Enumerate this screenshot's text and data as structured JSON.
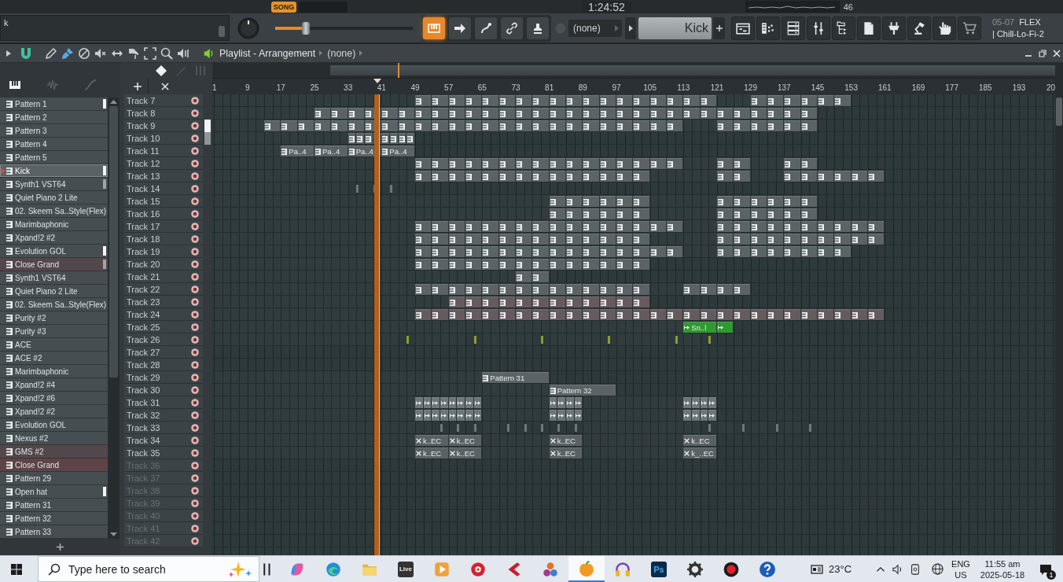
{
  "top_bar": {
    "mode": "SONG",
    "time": "1:24:52",
    "meter_reading": "46"
  },
  "toolbar": {
    "hint": "k",
    "song_position": {
      "level": 0.22
    },
    "tools": [
      {
        "on": true
      },
      {
        "on": false
      },
      {
        "on": false
      },
      {
        "on": false
      },
      {
        "on": false
      }
    ],
    "selector": "(none)",
    "pattern_field": "Kick",
    "project_info": [
      "05-07",
      "FLEX",
      "| Chill-Lo-Fi-2"
    ]
  },
  "playlist": {
    "title": "Playlist - Arrangement",
    "arrangement": "(none)",
    "tools": [
      {
        "selected": false
      },
      {
        "selected": true
      },
      {
        "selected": false
      },
      {
        "selected": false
      },
      {
        "selected": false
      },
      {
        "selected": false
      },
      {
        "selected": false
      },
      {
        "selected": false
      },
      {
        "selected": false
      }
    ],
    "picker_tabs": [
      {
        "selected": true
      },
      {
        "selected": false
      },
      {
        "selected": false
      }
    ],
    "patterns": [
      {
        "name": "Pattern 1",
        "selected": false,
        "marker": {
          "color": "#f2f4f5"
        }
      },
      {
        "name": "Pattern 2",
        "selected": false
      },
      {
        "name": "Pattern 3",
        "selected": false
      },
      {
        "name": "Pattern 4",
        "selected": false
      },
      {
        "name": "Pattern 5",
        "selected": false
      },
      {
        "name": "Kick",
        "selected": true,
        "marker": {
          "color": "#f2f4f5"
        }
      },
      {
        "name": "Synth1 VST64",
        "selected": false,
        "marker": {
          "color": "#9ea5a8"
        }
      },
      {
        "name": "Quiet Piano 2 Lite",
        "selected": false
      },
      {
        "name": "02. Skeem Sa..Style(Flex)",
        "selected": false
      },
      {
        "name": "Marimbaphonic",
        "selected": false
      },
      {
        "name": "Xpand!2 #2",
        "selected": false
      },
      {
        "name": "Evolution GOL",
        "selected": false,
        "marker": {
          "color": "#f2f4f5"
        }
      },
      {
        "name": "Close Grand",
        "selected": false,
        "color": "#54474b",
        "marker": {
          "color": "#9ea5a8"
        }
      },
      {
        "name": "Synth1 VST64",
        "selected": false
      },
      {
        "name": "Quiet Piano 2 Lite",
        "selected": false
      },
      {
        "name": "02. Skeem Sa..Style(Flex)",
        "selected": false
      },
      {
        "name": "Purity #2",
        "selected": false
      },
      {
        "name": "Purity #3",
        "selected": false
      },
      {
        "name": "ACE",
        "selected": false
      },
      {
        "name": "ACE #2",
        "selected": false
      },
      {
        "name": "Marimbaphonic",
        "selected": false
      },
      {
        "name": "Xpand!2 #4",
        "selected": false
      },
      {
        "name": "Xpand!2 #6",
        "selected": false
      },
      {
        "name": "Xpand!2 #2",
        "selected": false
      },
      {
        "name": "Evolution GOL",
        "selected": false
      },
      {
        "name": "Nexus #2",
        "selected": false
      },
      {
        "name": "GMS #2",
        "selected": false,
        "color": "#54474b"
      },
      {
        "name": "Close Grand",
        "selected": false,
        "color": "#5e4347"
      },
      {
        "name": "Pattern 29",
        "selected": false
      },
      {
        "name": "Open hat",
        "selected": false,
        "marker": {
          "color": "#f2f4f5"
        }
      },
      {
        "name": "Pattern 31",
        "selected": false
      },
      {
        "name": "Pattern 32",
        "selected": false
      },
      {
        "name": "Pattern 33",
        "selected": false
      }
    ],
    "ruler": [
      "1",
      "9",
      "17",
      "25",
      "33",
      "41",
      "49",
      "57",
      "65",
      "73",
      "81",
      "89",
      "97",
      "105",
      "113",
      "121",
      "129",
      "137",
      "145",
      "153",
      "161",
      "169",
      "177",
      "185",
      "193",
      "20"
    ],
    "playhead": {
      "level": 0.196
    },
    "tracks": [
      {
        "name": "Track 7",
        "dimmed": false,
        "kind": "pattern",
        "slots": [
          false,
          false,
          false,
          false,
          false,
          false,
          false,
          false,
          false,
          false,
          false,
          false,
          true,
          true,
          true,
          true,
          true,
          true,
          true,
          true,
          true,
          true,
          true,
          true,
          true,
          true,
          true,
          true,
          true,
          true,
          false,
          false,
          true,
          true,
          true,
          true,
          true,
          true
        ]
      },
      {
        "name": "Track 8",
        "dimmed": false,
        "kind": "pattern",
        "slots": [
          false,
          false,
          false,
          false,
          false,
          false,
          true,
          true,
          true,
          true,
          true,
          true,
          true,
          true,
          true,
          true,
          true,
          true,
          true,
          true,
          true,
          true,
          true,
          true,
          true,
          true,
          true,
          true,
          true,
          true,
          true,
          true,
          true,
          true,
          true,
          true
        ]
      },
      {
        "name": "Track 9",
        "dimmed": false,
        "kind": "pattern",
        "slots": [
          false,
          false,
          false,
          true,
          true,
          true,
          true,
          true,
          true,
          true,
          true,
          true,
          true,
          true,
          true,
          true,
          true,
          true,
          true,
          true,
          true,
          true,
          true,
          true,
          true,
          true,
          true,
          true,
          false,
          false,
          true,
          true,
          true,
          true,
          true,
          true
        ]
      },
      {
        "name": "Track 10",
        "dimmed": false,
        "kind": "split",
        "slots": [
          false,
          false,
          false,
          false,
          false,
          false,
          false,
          false,
          true,
          true,
          true,
          true
        ]
      },
      {
        "name": "Track 11",
        "dimmed": false,
        "kind": "wide",
        "labels": [
          "Pa..4",
          "Pa..4",
          "Pa..4",
          "Pa..4"
        ],
        "slots": [
          false,
          false,
          false,
          false,
          true,
          true,
          true,
          true,
          true,
          true,
          true,
          true
        ]
      },
      {
        "name": "Track 12",
        "dimmed": false,
        "kind": "pattern",
        "slots": [
          false,
          false,
          false,
          false,
          false,
          false,
          false,
          false,
          false,
          false,
          false,
          false,
          true,
          true,
          true,
          true,
          true,
          true,
          true,
          true,
          true,
          true,
          true,
          true,
          true,
          true,
          true,
          true,
          false,
          false,
          true,
          true,
          false,
          false,
          true,
          true
        ]
      },
      {
        "name": "Track 13",
        "dimmed": false,
        "kind": "pattern",
        "slots": [
          false,
          false,
          false,
          false,
          false,
          false,
          false,
          false,
          false,
          false,
          false,
          false,
          true,
          true,
          true,
          true,
          true,
          true,
          true,
          true,
          true,
          true,
          true,
          true,
          true,
          true,
          false,
          false,
          false,
          false,
          true,
          true,
          false,
          false,
          true,
          true,
          true,
          true,
          true,
          true
        ]
      },
      {
        "name": "Track 14",
        "dimmed": false,
        "kind": "marker",
        "color": "#6e7679",
        "slots": [
          false,
          false,
          false,
          false,
          false,
          false,
          false,
          false,
          true,
          true,
          true
        ]
      },
      {
        "name": "Track 15",
        "dimmed": false,
        "kind": "pattern",
        "slots": [
          false,
          false,
          false,
          false,
          false,
          false,
          false,
          false,
          false,
          false,
          false,
          false,
          false,
          false,
          false,
          false,
          false,
          false,
          false,
          false,
          true,
          true,
          true,
          true,
          true,
          true,
          false,
          false,
          false,
          false,
          true,
          true,
          true,
          true,
          true,
          true
        ]
      },
      {
        "name": "Track 16",
        "dimmed": false,
        "kind": "pattern",
        "slots": [
          false,
          false,
          false,
          false,
          false,
          false,
          false,
          false,
          false,
          false,
          false,
          false,
          false,
          false,
          false,
          false,
          false,
          false,
          false,
          false,
          true,
          true,
          true,
          true,
          true,
          true,
          false,
          false,
          false,
          false,
          true,
          true,
          true,
          true,
          true,
          true
        ]
      },
      {
        "name": "Track 17",
        "dimmed": false,
        "kind": "pattern",
        "slots": [
          false,
          false,
          false,
          false,
          false,
          false,
          false,
          false,
          false,
          false,
          false,
          false,
          true,
          true,
          true,
          true,
          true,
          true,
          true,
          true,
          true,
          true,
          true,
          true,
          true,
          true,
          true,
          true,
          false,
          false,
          true,
          true,
          true,
          true,
          true,
          true,
          true,
          true,
          true,
          true
        ]
      },
      {
        "name": "Track 18",
        "dimmed": false,
        "kind": "pattern",
        "slots": [
          false,
          false,
          false,
          false,
          false,
          false,
          false,
          false,
          false,
          false,
          false,
          false,
          true,
          true,
          true,
          true,
          true,
          true,
          true,
          true,
          true,
          true,
          true,
          true,
          true,
          true,
          false,
          false,
          false,
          false,
          true,
          true,
          true,
          true,
          true,
          true,
          true,
          true,
          true,
          true
        ]
      },
      {
        "name": "Track 19",
        "dimmed": false,
        "kind": "pattern",
        "slots": [
          false,
          false,
          false,
          false,
          false,
          false,
          false,
          false,
          false,
          false,
          false,
          false,
          true,
          true,
          true,
          true,
          true,
          true,
          true,
          true,
          true,
          true,
          true,
          true,
          true,
          true,
          true,
          true,
          false,
          false,
          true,
          true,
          true,
          true,
          true,
          true,
          true,
          true
        ]
      },
      {
        "name": "Track 20",
        "dimmed": false,
        "kind": "pattern",
        "slots": [
          false,
          false,
          false,
          false,
          false,
          false,
          false,
          false,
          false,
          false,
          false,
          false,
          true,
          true,
          true,
          true,
          true,
          true,
          true,
          true,
          true,
          true,
          true,
          true,
          true,
          true
        ]
      },
      {
        "name": "Track 21",
        "dimmed": false,
        "kind": "pattern",
        "slots": [
          false,
          false,
          false,
          false,
          false,
          false,
          false,
          false,
          false,
          false,
          false,
          false,
          false,
          false,
          false,
          false,
          false,
          false,
          true,
          true
        ]
      },
      {
        "name": "Track 22",
        "dimmed": false,
        "kind": "pattern",
        "slots": [
          false,
          false,
          false,
          false,
          false,
          false,
          false,
          false,
          false,
          false,
          false,
          false,
          true,
          true,
          true,
          true,
          true,
          true,
          true,
          true,
          true,
          true,
          true,
          true,
          true,
          true,
          false,
          false,
          true,
          true,
          true,
          true
        ]
      },
      {
        "name": "Track 23",
        "dimmed": false,
        "kind": "pattern",
        "color": "#655b5e",
        "slots": [
          false,
          false,
          false,
          false,
          false,
          false,
          false,
          false,
          false,
          false,
          false,
          false,
          false,
          false,
          true,
          true,
          true,
          true,
          true,
          true,
          true,
          true,
          true,
          true,
          true,
          true
        ]
      },
      {
        "name": "Track 24",
        "dimmed": false,
        "kind": "pattern",
        "color": "#655b5e",
        "slots": [
          false,
          false,
          false,
          false,
          false,
          false,
          false,
          false,
          false,
          false,
          false,
          false,
          true,
          true,
          true,
          true,
          true,
          true,
          true,
          true,
          true,
          true,
          true,
          true,
          true,
          true,
          true,
          true,
          true,
          true,
          true,
          true,
          true,
          true,
          true,
          true,
          true,
          true,
          true,
          true
        ]
      },
      {
        "name": "Track 25",
        "dimmed": false,
        "kind": "audio",
        "color": "#2f9a2f",
        "labels": [
          "Sn..l"
        ],
        "slots": [
          false,
          false,
          false,
          false,
          false,
          false,
          false,
          false,
          false,
          false,
          false,
          false,
          false,
          false,
          false,
          false,
          false,
          false,
          false,
          false,
          false,
          false,
          false,
          false,
          false,
          false,
          false,
          false,
          true,
          true,
          true
        ]
      },
      {
        "name": "Track 26",
        "dimmed": false,
        "kind": "marker",
        "color": "#8f9b2c",
        "slots": [
          false,
          false,
          false,
          false,
          false,
          false,
          false,
          false,
          false,
          false,
          false,
          true,
          false,
          false,
          false,
          true,
          false,
          false,
          false,
          true,
          false,
          false,
          false,
          true,
          false,
          false,
          false,
          true,
          false,
          true
        ]
      },
      {
        "name": "Track 27",
        "dimmed": false
      },
      {
        "name": "Track 28",
        "dimmed": false
      },
      {
        "name": "Track 29",
        "dimmed": false,
        "kind": "long",
        "labels": [
          "Pattern 31"
        ],
        "slots": [
          false,
          false,
          false,
          false,
          false,
          false,
          false,
          false,
          false,
          false,
          false,
          false,
          false,
          false,
          false,
          false,
          true,
          true,
          true,
          true
        ]
      },
      {
        "name": "Track 30",
        "dimmed": false,
        "kind": "long",
        "labels": [
          "Pattern 32"
        ],
        "slots": [
          false,
          false,
          false,
          false,
          false,
          false,
          false,
          false,
          false,
          false,
          false,
          false,
          false,
          false,
          false,
          false,
          false,
          false,
          false,
          false,
          true,
          true,
          true,
          true
        ]
      },
      {
        "name": "Track 31",
        "dimmed": false,
        "kind": "snippets",
        "color": "#6d767a",
        "slots": [
          false,
          false,
          false,
          false,
          false,
          false,
          false,
          false,
          false,
          false,
          false,
          false,
          true,
          true,
          true,
          true,
          false,
          false,
          false,
          false,
          true,
          true,
          false,
          false,
          false,
          false,
          false,
          false,
          true,
          true
        ]
      },
      {
        "name": "Track 32",
        "dimmed": false,
        "kind": "snippets",
        "color": "#6d767a",
        "slots": [
          false,
          false,
          false,
          false,
          false,
          false,
          false,
          false,
          false,
          false,
          false,
          false,
          true,
          true,
          true,
          true,
          false,
          false,
          false,
          false,
          true,
          true,
          false,
          false,
          false,
          false,
          false,
          false,
          true,
          true
        ]
      },
      {
        "name": "Track 33",
        "dimmed": false,
        "kind": "marker",
        "color": "#6e7679",
        "slots": [
          false,
          false,
          false,
          false,
          false,
          false,
          false,
          false,
          false,
          false,
          false,
          false,
          false,
          true,
          true,
          true,
          false,
          true,
          true,
          true,
          true,
          true,
          false,
          false,
          false,
          false,
          false,
          false,
          false,
          true,
          false,
          true,
          false,
          true,
          false,
          true
        ]
      },
      {
        "name": "Track 34",
        "dimmed": false,
        "kind": "crossed",
        "labels": [
          "k..EC",
          "k..EC",
          "k..EC",
          "k..EC"
        ],
        "slots": [
          false,
          false,
          false,
          false,
          false,
          false,
          false,
          false,
          false,
          false,
          false,
          false,
          true,
          true,
          true,
          true,
          false,
          false,
          false,
          false,
          true,
          true,
          false,
          false,
          false,
          false,
          false,
          false,
          true,
          true
        ]
      },
      {
        "name": "Track 35",
        "dimmed": false,
        "kind": "crossed",
        "labels": [
          "k..EC",
          "k..EC",
          "k..EC",
          "k_..EC"
        ],
        "slots": [
          false,
          false,
          false,
          false,
          false,
          false,
          false,
          false,
          false,
          false,
          false,
          false,
          true,
          true,
          true,
          true,
          false,
          false,
          false,
          false,
          true,
          true,
          false,
          false,
          false,
          false,
          false,
          false,
          true,
          true
        ]
      },
      {
        "name": "Track 36",
        "dimmed": true
      },
      {
        "name": "Track 37",
        "dimmed": true
      },
      {
        "name": "Track 38",
        "dimmed": true
      },
      {
        "name": "Track 39",
        "dimmed": true
      },
      {
        "name": "Track 40",
        "dimmed": true
      },
      {
        "name": "Track 41",
        "dimmed": true
      },
      {
        "name": "Track 42",
        "dimmed": true
      }
    ]
  },
  "taskbar": {
    "search_placeholder": "Type here to search",
    "apps": [
      {
        "selected": false
      },
      {
        "selected": false
      },
      {
        "selected": false
      },
      {
        "selected": false
      },
      {
        "label": "Live",
        "selected": false
      },
      {
        "selected": false
      },
      {
        "selected": false
      },
      {
        "selected": false
      },
      {
        "selected": false
      },
      {
        "selected": true
      },
      {
        "selected": false
      },
      {
        "label": "Ps",
        "selected": false
      },
      {
        "selected": false
      },
      {
        "selected": false
      },
      {
        "selected": false
      }
    ],
    "weather": "23°C",
    "language": "ENG",
    "region": "US",
    "time": "11:55 am",
    "date": "2025-05-18",
    "notifications": "1"
  }
}
